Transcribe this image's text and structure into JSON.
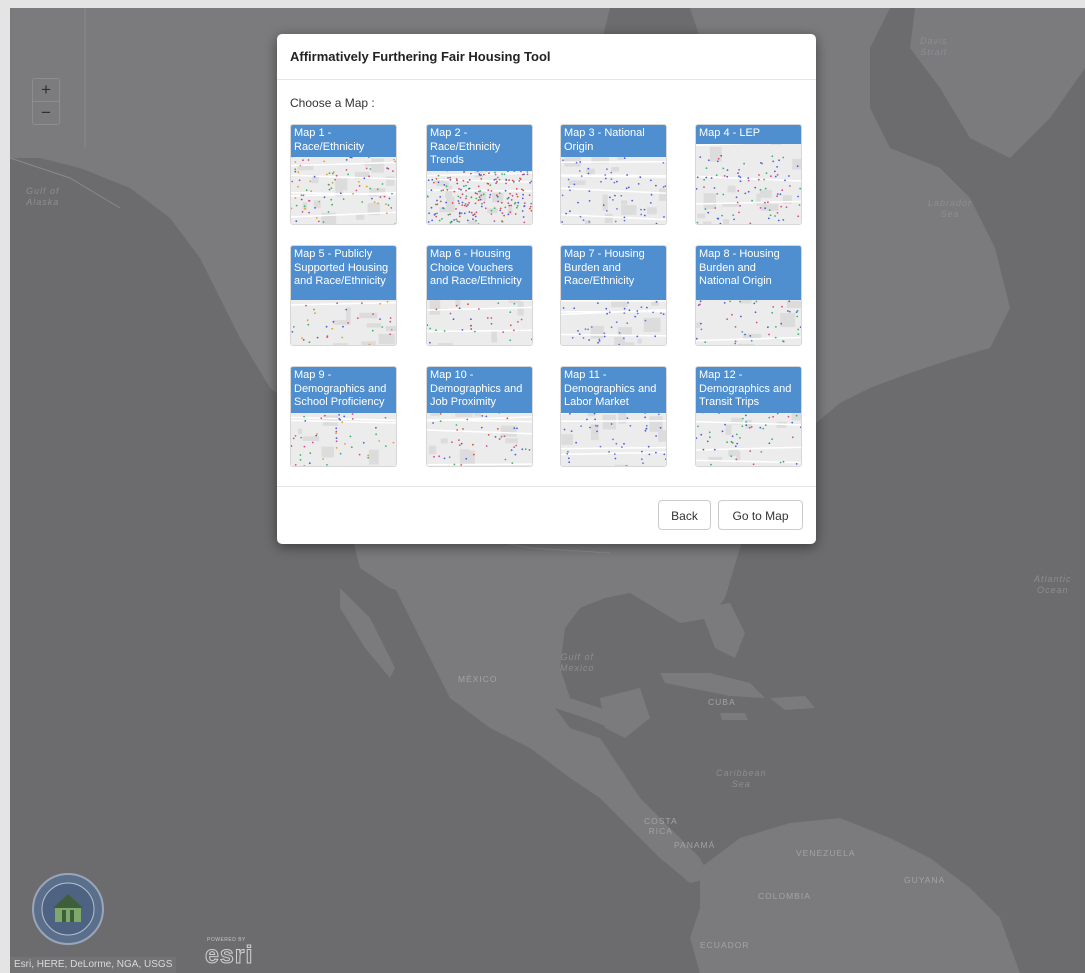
{
  "colors": {
    "accent": "#4f8fd0",
    "overlay": "#6e6e70",
    "land": "#7b7b7d",
    "water": "#6c6c6e"
  },
  "map": {
    "zoom_in": "+",
    "zoom_out": "−",
    "labels": {
      "davis_strait": "Davis\nStrait",
      "gulf_alaska": "Gulf of\nAlaska",
      "labrador_sea": "Labrador\nSea",
      "atlantic": "Atlantic\nOcean",
      "gulf_mexico": "Gulf of\nMexico",
      "caribbean": "Caribbean\nSea",
      "mexico": "MÉXICO",
      "cuba": "CUBA",
      "costa_rica": "COSTA\nRICA",
      "panama": "PANAMÁ",
      "venezuela": "VENEZUELA",
      "guyana": "GUYANA",
      "colombia": "COLOMBIA",
      "ecuador": "ECUADOR"
    },
    "attribution": "Esri, HERE, DeLorme, NGA, USGS",
    "esri_powered": "POWERED BY",
    "esri_text": "esri"
  },
  "modal": {
    "title": "Affirmatively Furthering Fair Housing Tool",
    "choose_label": "Choose a Map :",
    "maps": [
      {
        "label": "Map 1 - Race/Ethnicity"
      },
      {
        "label": "Map 2 - Race/Ethnicity Trends"
      },
      {
        "label": "Map 3 - National Origin"
      },
      {
        "label": "Map 4 - LEP"
      },
      {
        "label": "Map 5 - Publicly Supported Housing and Race/Ethnicity"
      },
      {
        "label": "Map 6 - Housing Choice Vouchers and Race/Ethnicity"
      },
      {
        "label": "Map 7 - Housing Burden and Race/Ethnicity"
      },
      {
        "label": "Map 8 - Housing Burden and National Origin"
      },
      {
        "label": "Map 9 - Demographics and School Proficiency"
      },
      {
        "label": "Map 10 - Demographics and Job Proximity"
      },
      {
        "label": "Map 11 - Demographics and Labor Market"
      },
      {
        "label": "Map 12 - Demographics and Transit Trips"
      }
    ],
    "back_label": "Back",
    "go_label": "Go to Map"
  }
}
